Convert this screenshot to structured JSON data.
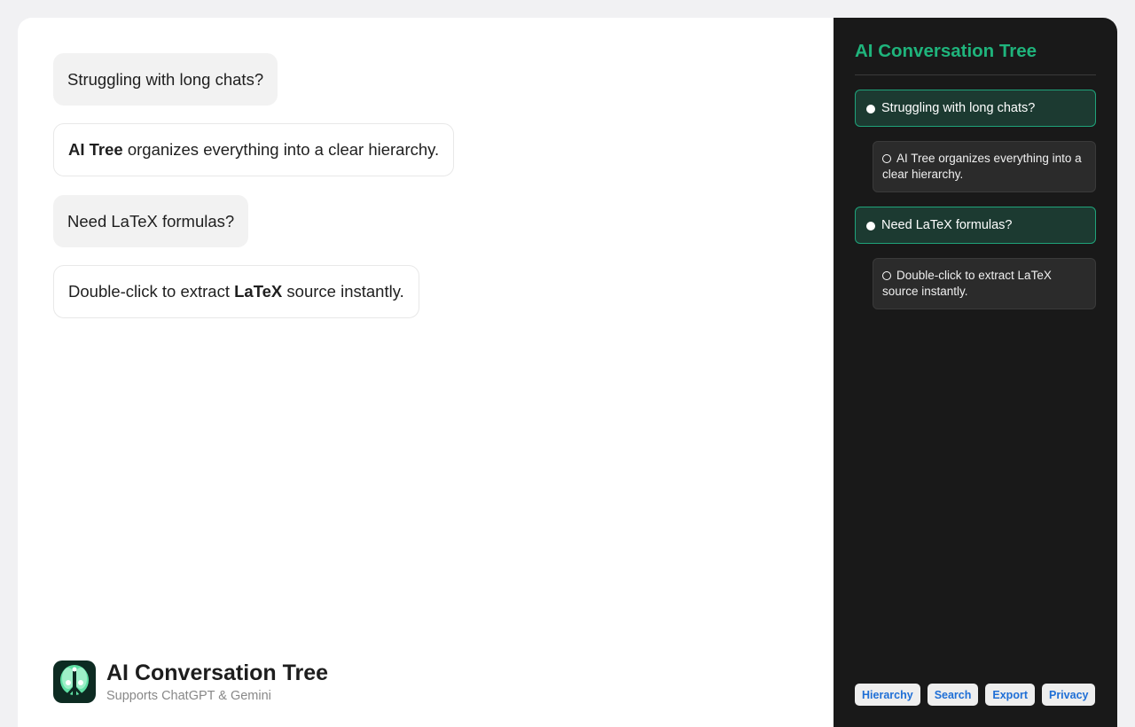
{
  "chat": {
    "messages": [
      {
        "role": "user",
        "text": "Struggling with long chats?"
      },
      {
        "role": "ai",
        "bold": "AI Tree",
        "rest": " organizes everything into a clear hierarchy."
      },
      {
        "role": "user",
        "text": "Need LaTeX formulas?"
      },
      {
        "role": "ai",
        "pre": "Double-click to extract ",
        "bold": "LaTeX",
        "post": " source instantly."
      }
    ]
  },
  "brand": {
    "title": "AI Conversation Tree",
    "subtitle": "Supports ChatGPT & Gemini",
    "logo_icon": "tree-logo-icon"
  },
  "sidebar": {
    "title": "AI Conversation Tree",
    "nodes": [
      {
        "label": "Struggling with long chats?",
        "children": [
          {
            "label": "AI Tree organizes everything into a clear hierarchy."
          }
        ]
      },
      {
        "label": "Need LaTeX formulas?",
        "children": [
          {
            "label": "Double-click to extract LaTeX source instantly."
          }
        ]
      }
    ],
    "toolbar": [
      "Hierarchy",
      "Search",
      "Export",
      "Privacy"
    ]
  },
  "colors": {
    "accent": "#1fb47c",
    "link": "#1f6fd6",
    "sidebar_bg": "#191919"
  }
}
